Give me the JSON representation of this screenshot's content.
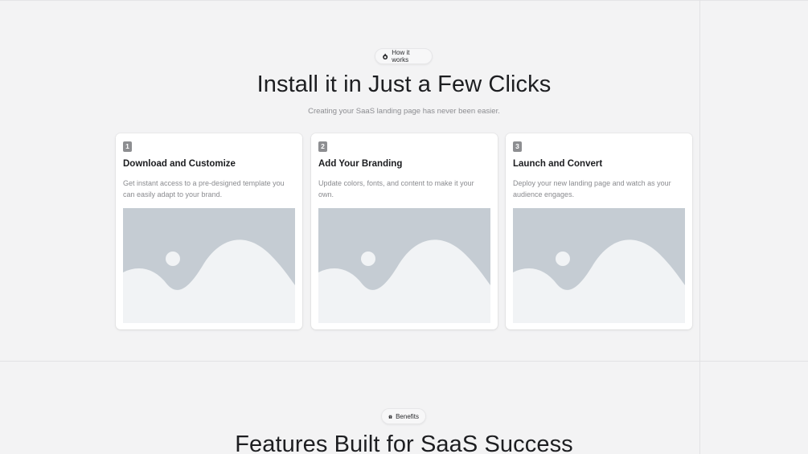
{
  "how_it_works": {
    "badge_label": "How it works",
    "badge_icon": "hand-pointer-icon",
    "title": "Install it in Just a Few Clicks",
    "subtitle": "Creating your SaaS landing page has never been easier."
  },
  "steps": [
    {
      "number": "1",
      "title": "Download and Customize",
      "description": "Get instant access to a pre-designed template you can easily adapt to your brand.",
      "image": "image-placeholder-icon"
    },
    {
      "number": "2",
      "title": "Add Your Branding",
      "description": "Update colors, fonts, and content to make it your own.",
      "image": "image-placeholder-icon"
    },
    {
      "number": "3",
      "title": "Launch and Convert",
      "description": "Deploy your new landing page and watch as your audience engages.",
      "image": "image-placeholder-icon"
    }
  ],
  "benefits": {
    "badge_label": "Benefits",
    "badge_icon": "gift-icon",
    "title": "Features Built for SaaS Success"
  },
  "colors": {
    "page_background": "#f3f3f4",
    "card_background": "#ffffff",
    "step_badge": "#8d8e91",
    "placeholder_fill": "#c5ccd3",
    "placeholder_shape": "#f1f3f5"
  }
}
